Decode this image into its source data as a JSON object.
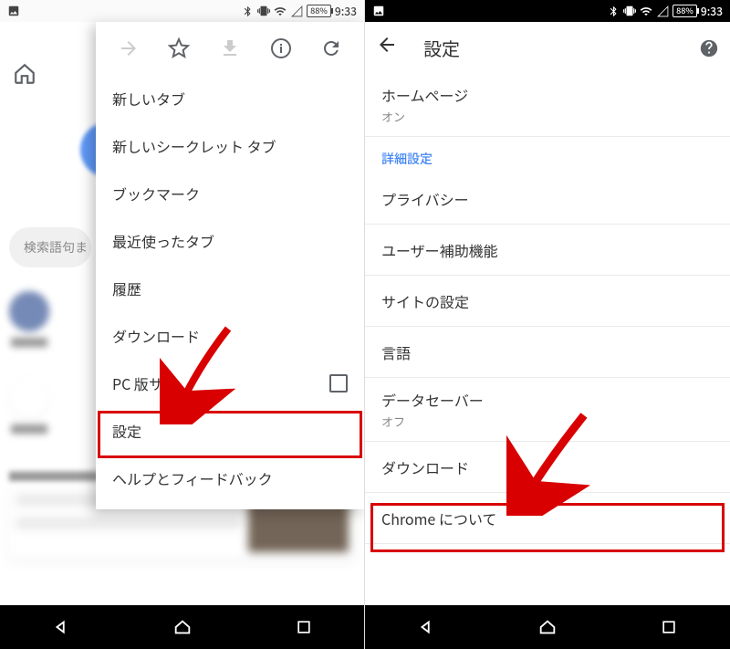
{
  "status": {
    "battery": "88%",
    "time": "9:33"
  },
  "left": {
    "search_hint": "検索語句ま",
    "menu": {
      "items": [
        "新しいタブ",
        "新しいシークレット タブ",
        "ブックマーク",
        "最近使ったタブ",
        "履歴",
        "ダウンロード",
        "PC 版サイ",
        "設定",
        "ヘルプとフィードバック"
      ]
    }
  },
  "right": {
    "title": "設定",
    "homepage": {
      "label": "ホームページ",
      "value": "オン"
    },
    "advanced_section": "詳細設定",
    "items": {
      "privacy": "プライバシー",
      "accessibility": "ユーザー補助機能",
      "site_settings": "サイトの設定",
      "language": "言語",
      "data_saver": {
        "label": "データセーバー",
        "value": "オフ"
      },
      "download": "ダウンロード",
      "about": "Chrome について"
    }
  }
}
